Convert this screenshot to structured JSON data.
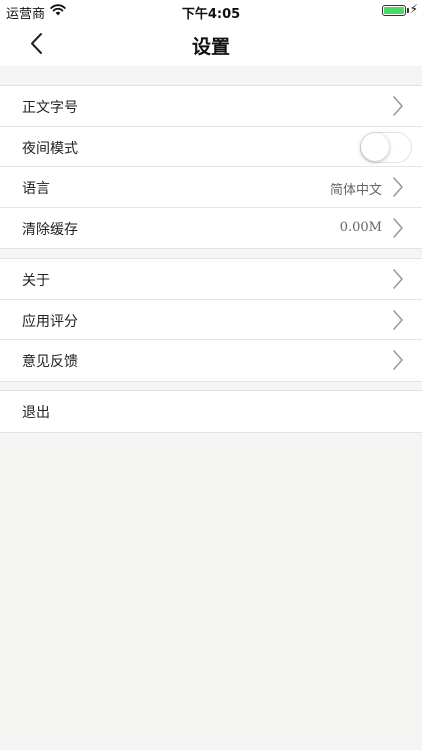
{
  "status_bar": {
    "carrier": "运营商",
    "time": "下午4:05",
    "battery_level": 1.0
  },
  "nav": {
    "title": "设置",
    "back_icon": "chevron-left-icon"
  },
  "groups": [
    {
      "rows": [
        {
          "label": "正文字号",
          "value": "",
          "accessory": "chevron"
        },
        {
          "label": "夜间模式",
          "value": "",
          "accessory": "toggle",
          "toggle_on": false
        },
        {
          "label": "语言",
          "value": "简体中文",
          "accessory": "chevron"
        },
        {
          "label": "清除缓存",
          "value": "0.00M",
          "accessory": "chevron"
        }
      ]
    },
    {
      "rows": [
        {
          "label": "关于",
          "accessory": "chevron"
        },
        {
          "label": "应用评分",
          "accessory": "chevron"
        },
        {
          "label": "意见反馈",
          "accessory": "chevron"
        }
      ]
    },
    {
      "rows": [
        {
          "label": "退出"
        }
      ]
    }
  ],
  "colors": {
    "background": "#f5f5f4",
    "surface": "#ffffff",
    "battery": "#4cd964",
    "chevron": "#9a9a9a"
  }
}
